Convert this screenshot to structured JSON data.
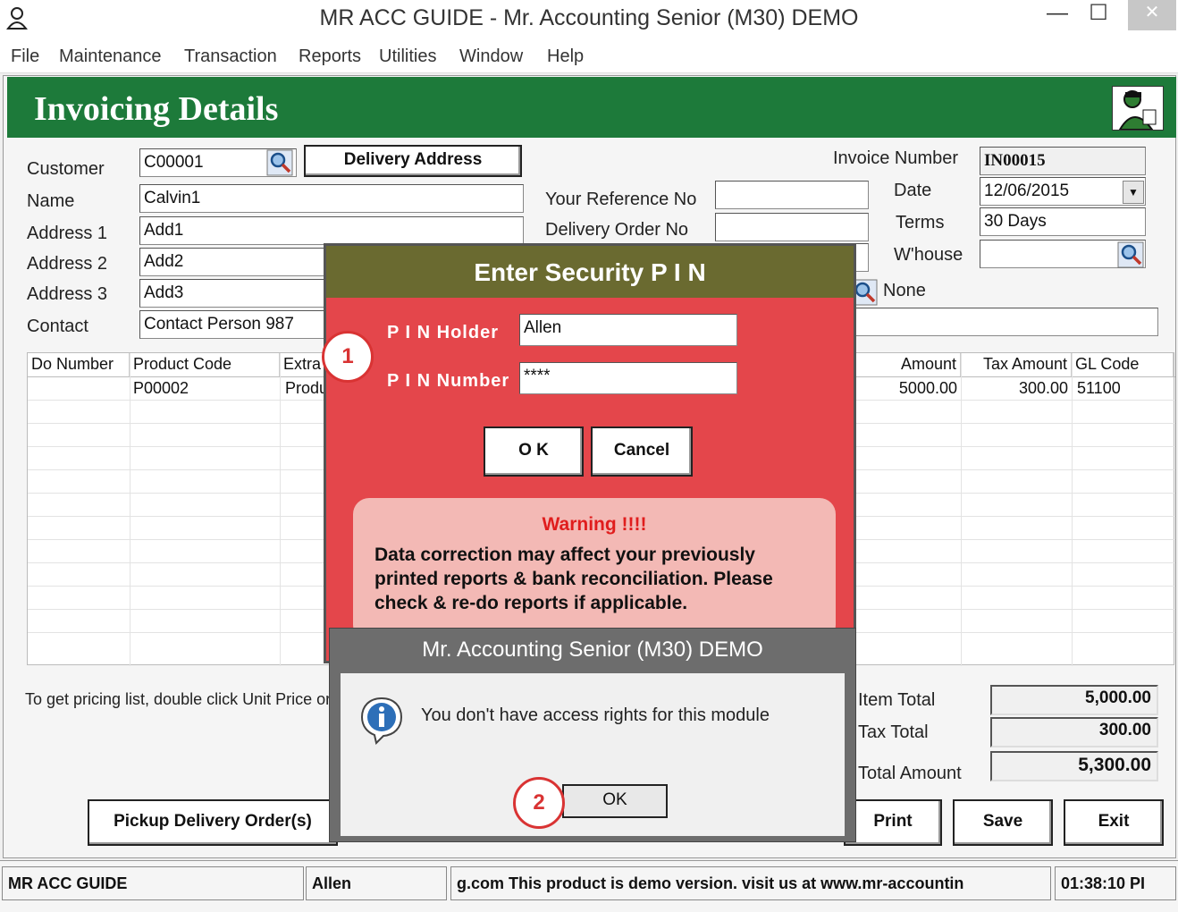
{
  "window": {
    "title": "MR ACC GUIDE - Mr. Accounting Senior (M30) DEMO",
    "minimize": "—",
    "maximize": "☐",
    "close": "✕"
  },
  "menu": [
    "File",
    "Maintenance",
    "Transaction",
    "Reports",
    "Utilities",
    "Window",
    "Help"
  ],
  "header": {
    "title": "Invoicing Details"
  },
  "form": {
    "customer_label": "Customer",
    "customer_value": "C00001",
    "delivery_address_button": "Delivery Address",
    "name_label": "Name",
    "name_value": "Calvin1",
    "address1_label": "Address 1",
    "address1_value": "Add1",
    "address2_label": "Address 2",
    "address2_value": "Add2",
    "address3_label": "Address 3",
    "address3_value": "Add3",
    "contact_label": "Contact",
    "contact_value": "Contact Person     987",
    "your_ref_label": "Your Reference No",
    "your_ref_value": "",
    "delivery_order_label": "Delivery Order No",
    "delivery_order_value": "",
    "invoice_number_label": "Invoice Number",
    "invoice_number_value": "IN00015",
    "date_label": "Date",
    "date_value": "12/06/2015",
    "terms_label": "Terms",
    "terms_value": "30 Days",
    "whouse_label": "W'house",
    "whouse_value": "",
    "none_label": "None"
  },
  "grid": {
    "columns": [
      "Do Number",
      "Product Code",
      "Extra",
      "Amount",
      "Tax Amount",
      "GL Code"
    ],
    "rows": [
      {
        "do_number": "",
        "product_code": "P00002",
        "extra": "Produ",
        "amount": "5000.00",
        "tax_amount": "300.00",
        "gl_code": "51100"
      }
    ]
  },
  "hint": "To get pricing list, double click Unit Price or",
  "totals": {
    "item_total_label": "Item Total",
    "item_total_value": "5,000.00",
    "tax_total_label": "Tax Total",
    "tax_total_value": "300.00",
    "total_amount_label": "Total Amount",
    "total_amount_value": "5,300.00"
  },
  "buttons": {
    "pickup": "Pickup Delivery Order(s)",
    "print": "Print",
    "save": "Save",
    "exit": "Exit"
  },
  "pin_dialog": {
    "title": "Enter Security P I N",
    "holder_label": "P I N Holder",
    "holder_value": "Allen",
    "number_label": "P I N Number",
    "number_value": "****",
    "ok": "O K",
    "cancel": "Cancel",
    "warning_title": "Warning !!!!",
    "warning_text": "Data correction may affect your previously printed reports & bank reconciliation. Please check & re-do reports if applicable."
  },
  "message_box": {
    "title": "Mr. Accounting Senior (M30) DEMO",
    "text": "You don't have access rights for this module",
    "ok": "OK"
  },
  "status_bar": {
    "app": "MR ACC GUIDE",
    "user": "Allen",
    "marquee": "g.com This product is demo version.  visit us at www.mr-accountin",
    "time": "01:38:10 PI"
  },
  "markers": [
    "1",
    "2"
  ],
  "colors": {
    "header": "#1d7a3a",
    "pin_bg": "#e4464b",
    "pin_title": "#6a6a30",
    "warning": "#e01d1d",
    "marker": "#d93333"
  }
}
